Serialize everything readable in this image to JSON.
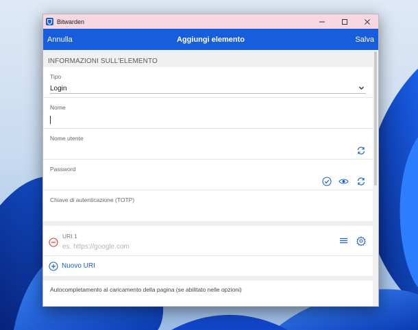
{
  "window": {
    "title": "Bitwarden"
  },
  "header": {
    "cancel": "Annulla",
    "title": "Aggiungi elemento",
    "save": "Salva"
  },
  "section": {
    "title": "INFORMAZIONI SULL'ELEMENTO"
  },
  "fields": {
    "type": {
      "label": "Tipo",
      "value": "Login"
    },
    "name": {
      "label": "Nome",
      "value": ""
    },
    "username": {
      "label": "Nome utente",
      "value": ""
    },
    "password": {
      "label": "Password",
      "value": ""
    },
    "totp": {
      "label": "Chiave di autenticazione (TOTP)",
      "value": ""
    }
  },
  "uri": {
    "label": "URI 1",
    "placeholder": "es. https://google.com",
    "new_label": "Nuovo URI"
  },
  "autofill": {
    "label": "Autocompletamento al caricamento della pagina (se abilitato nelle opzioni)"
  },
  "colors": {
    "accent": "#175ddc",
    "titlebar": "#f6d7e2",
    "remove": "#e0342b"
  },
  "icons": [
    "bitwarden-logo",
    "minimize-icon",
    "maximize-icon",
    "close-icon",
    "chevron-down-icon",
    "refresh-icon",
    "check-circle-icon",
    "eye-icon",
    "minus-circle-icon",
    "list-icon",
    "gear-icon",
    "plus-circle-icon"
  ]
}
